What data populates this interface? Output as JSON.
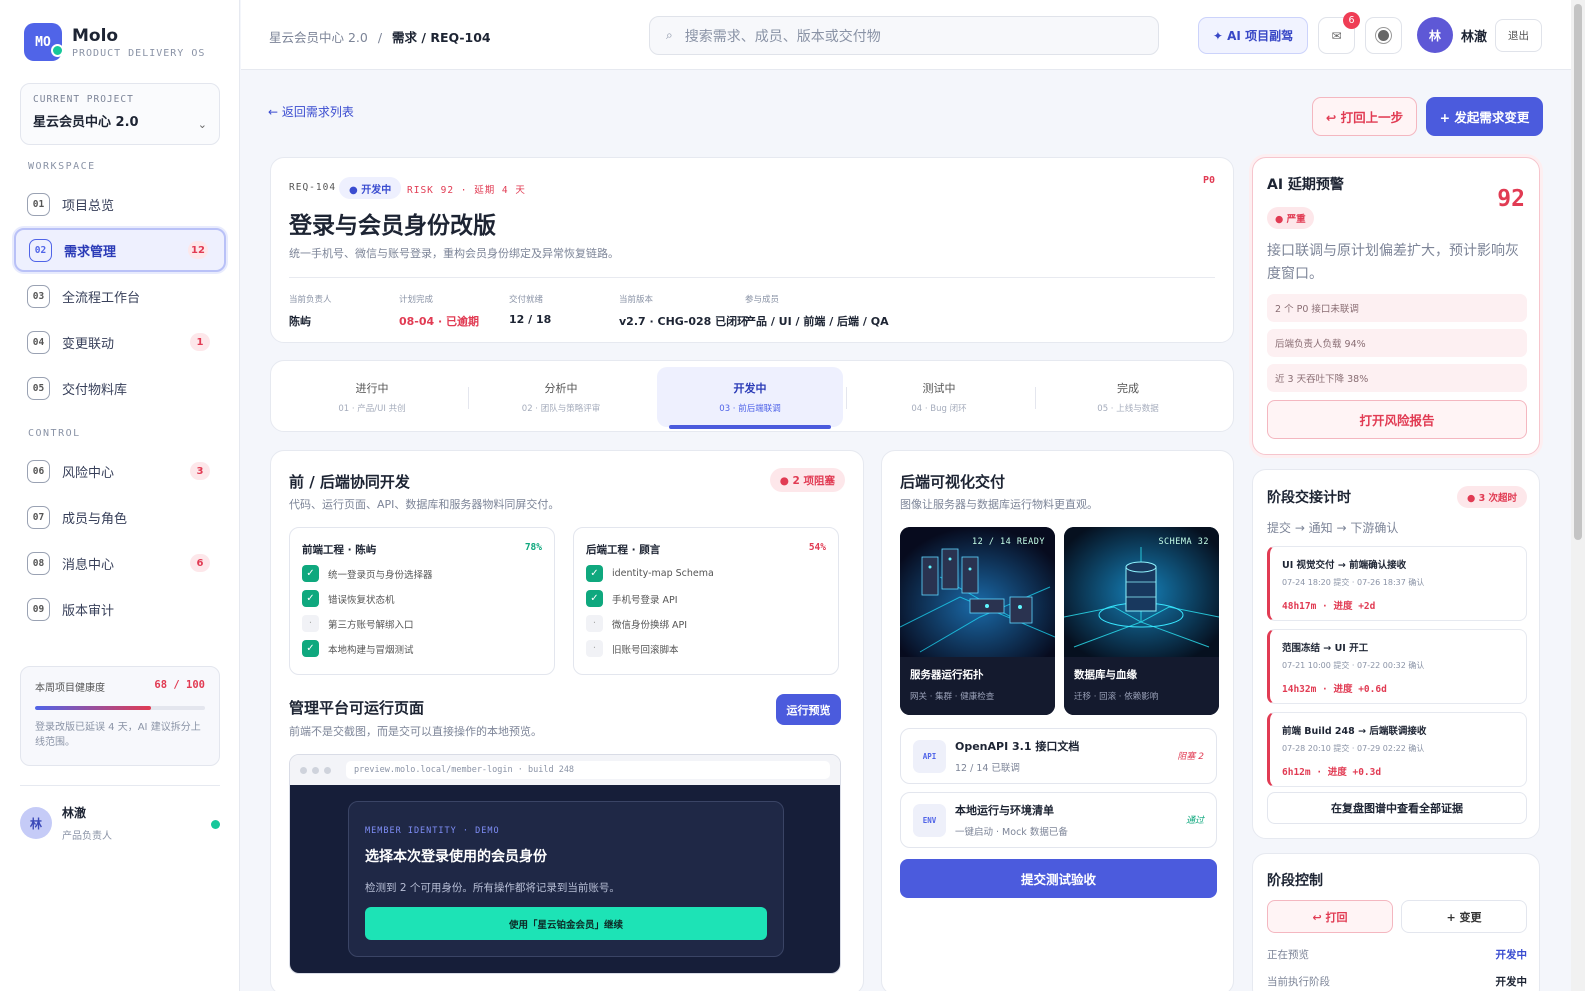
{
  "brand": {
    "logo": "MO",
    "name": "Molo",
    "subtitle": "PRODUCT DELIVERY OS"
  },
  "project": {
    "label": "CURRENT PROJECT",
    "name": "星云会员中心 2.0"
  },
  "sidebar": {
    "workspace_label": "WORKSPACE",
    "control_label": "CONTROL",
    "items": [
      {
        "num": "01",
        "label": "项目总览",
        "count": ""
      },
      {
        "num": "02",
        "label": "需求管理",
        "count": "12"
      },
      {
        "num": "03",
        "label": "全流程工作台",
        "count": ""
      },
      {
        "num": "04",
        "label": "变更联动",
        "count": "1"
      },
      {
        "num": "05",
        "label": "交付物料库",
        "count": ""
      },
      {
        "num": "06",
        "label": "风险中心",
        "count": "3"
      },
      {
        "num": "07",
        "label": "成员与角色",
        "count": ""
      },
      {
        "num": "08",
        "label": "消息中心",
        "count": "6"
      },
      {
        "num": "09",
        "label": "版本审计",
        "count": ""
      }
    ],
    "active_index": 1
  },
  "health": {
    "label": "本周项目健康度",
    "score": "68 / 100",
    "fraction": 0.68,
    "desc": "登录改版已延误 4 天，AI 建议拆分上线范围。"
  },
  "user": {
    "avatar": "林",
    "name": "林澈",
    "role": "产品负责人"
  },
  "topbar": {
    "crumb_root": "星云会员中心 2.0",
    "crumb_sep": "/",
    "crumb_current": "需求 / REQ-104",
    "search_placeholder": "搜索需求、成员、版本或交付物",
    "ai_button": "✦ AI 项目副驾",
    "msg_badge": "6",
    "logout": "退出"
  },
  "actions": {
    "back": "← 返回需求列表",
    "rollback": "↩ 打回上一步",
    "change": "+ 发起需求变更"
  },
  "requirement": {
    "id": "REQ-104",
    "status": "● 开发中",
    "risk": "RISK 92 · 延期 4 天",
    "priority": "P0",
    "title": "登录与会员身份改版",
    "desc": "统一手机号、微信与账号登录，重构会员身份绑定及异常恢复链路。",
    "meta": [
      {
        "k": "当前负责人",
        "v": "陈屿"
      },
      {
        "k": "计划完成",
        "v": "08-04 · 已逾期"
      },
      {
        "k": "交付就绪",
        "v": "12 / 18"
      },
      {
        "k": "当前版本",
        "v": "v2.7 · CHG-028 已闭环"
      },
      {
        "k": "参与成员",
        "v": "产品 / UI / 前端 / 后端 / QA"
      }
    ]
  },
  "stages": [
    {
      "t": "进行中",
      "s": "01 · 产品/UI 共创"
    },
    {
      "t": "分析中",
      "s": "02 · 团队与策略评审"
    },
    {
      "t": "开发中",
      "s": "03 · 前后端联调"
    },
    {
      "t": "测试中",
      "s": "04 · Bug 闭环"
    },
    {
      "t": "完成",
      "s": "05 · 上线与数据"
    }
  ],
  "dev": {
    "title": "前 / 后端协同开发",
    "sub": "代码、运行页面、API、数据库和服务器物料同屏交付。",
    "blocker": "● 2 项阻塞",
    "frontend": {
      "title": "前端工程 · 陈屿",
      "pct": "78%",
      "items": [
        {
          "t": "统一登录页与身份选择器",
          "done": true
        },
        {
          "t": "错误恢复状态机",
          "done": true
        },
        {
          "t": "第三方账号解绑入口",
          "done": false
        },
        {
          "t": "本地构建与冒烟测试",
          "done": true
        }
      ]
    },
    "backend": {
      "title": "后端工程 · 顾言",
      "pct": "54%",
      "items": [
        {
          "t": "identity-map Schema",
          "done": true
        },
        {
          "t": "手机号登录 API",
          "done": true
        },
        {
          "t": "微信身份换绑 API",
          "done": false
        },
        {
          "t": "旧账号回滚脚本",
          "done": false
        }
      ]
    }
  },
  "preview": {
    "title": "管理平台可运行页面",
    "sub": "前端不是交截图，而是交可以直接操作的本地预览。",
    "button": "运行预览",
    "url": "preview.molo.local/member-login · build 248",
    "m1": "MEMBER IDENTITY · DEMO",
    "m2": "选择本次登录使用的会员身份",
    "m3": "检测到 2 个可用身份。所有操作都将记录到当前账号。",
    "m4": "使用「星云铂金会员」继续"
  },
  "backend_delivery": {
    "title": "后端可视化交付",
    "sub": "图像让服务器与数据库运行物料更直观。",
    "images": [
      {
        "tag": "12 / 14 READY",
        "c1": "服务器运行拓扑",
        "c2": "网关 · 集群 · 健康检查"
      },
      {
        "tag": "SCHEMA 32",
        "c1": "数据库与血缘",
        "c2": "迁移 · 回滚 · 依赖影响"
      }
    ],
    "docs": [
      {
        "icon": "API",
        "t": "OpenAPI 3.1 接口文档",
        "s": "12 / 14 已联调",
        "st": "阻塞 2",
        "color": "#e13b53"
      },
      {
        "icon": "ENV",
        "t": "本地运行与环境清单",
        "s": "一键启动 · Mock 数据已备",
        "st": "通过",
        "color": "#0fa87e"
      }
    ],
    "submit": "提交测试验收"
  },
  "ai_alert": {
    "title": "AI 延期预警",
    "score": "92",
    "severity": "● 严重",
    "text": "接口联调与原计划偏差扩大，预计影响灰度窗口。",
    "rows": [
      "2 个 P0 接口未联调",
      "后端负责人负载 94%",
      "近 3 天吞吐下降 38%"
    ],
    "report": "打开风险报告"
  },
  "handoff": {
    "title": "阶段交接计时",
    "overtime": "● 3 次超时",
    "sub": "提交 → 通知 → 下游确认",
    "items": [
      {
        "a": "UI 视觉交付 → 前端确认接收",
        "b": "07-24 18:20 提交 · 07-26 18:37 确认",
        "c": "48h17m · 进度 +2d"
      },
      {
        "a": "范围冻结 → UI 开工",
        "b": "07-21 10:00 提交 · 07-22 00:32 确认",
        "c": "14h32m · 进度 +0.6d"
      },
      {
        "a": "前端 Build 248 → 后端联调接收",
        "b": "07-28 20:10 提交 · 07-29 02:22 确认",
        "c": "6h12m · 进度 +0.3d"
      }
    ],
    "evidence": "在复盘图谱中查看全部证据"
  },
  "control": {
    "title": "阶段控制",
    "reject": "↩ 打回",
    "change": "+ 变更",
    "rows": [
      {
        "k": "正在预览",
        "v": "开发中"
      },
      {
        "k": "当前执行阶段",
        "v": "开发中"
      }
    ]
  },
  "colors": {
    "accent": "#4b5bdd",
    "danger": "#e13b53",
    "success": "#0fa87e"
  }
}
